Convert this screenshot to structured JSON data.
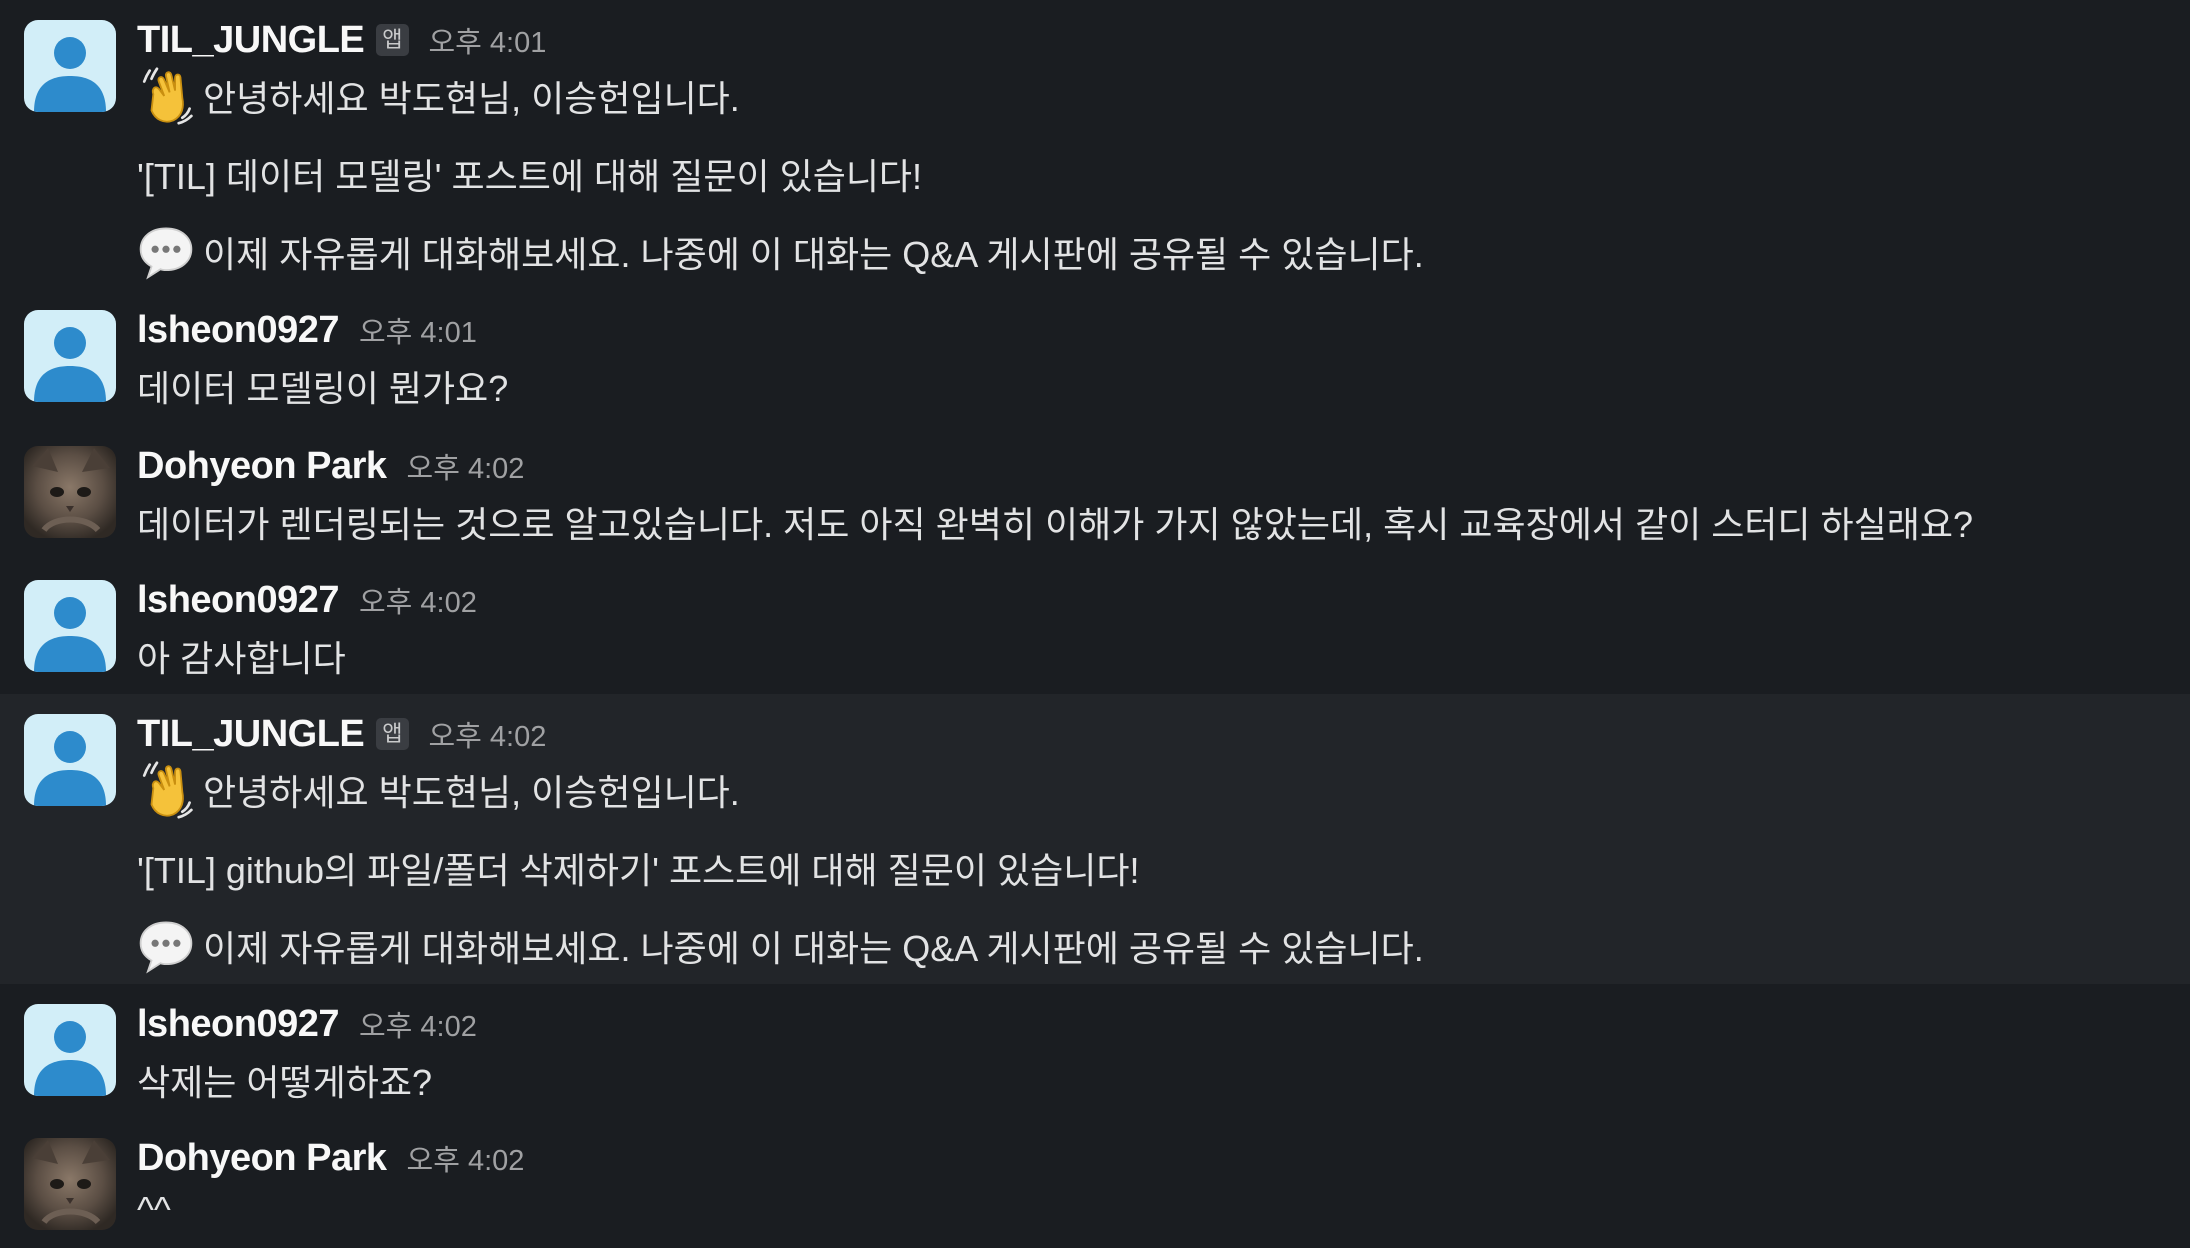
{
  "messages": [
    {
      "author": "TIL_JUNGLE",
      "badge": "앱",
      "time": "오후 4:01",
      "greeting": "안녕하세요 박도현님, 이승헌입니다.",
      "question": "'[TIL] 데이터 모델링' 포스트에 대해 질문이 있습니다!",
      "notice": "이제 자유롭게 대화해보세요. 나중에 이 대화는 Q&A 게시판에 공유될 수 있습니다."
    },
    {
      "author": "lsheon0927",
      "time": "오후 4:01",
      "text": "데이터 모델링이 뭔가요?"
    },
    {
      "author": "Dohyeon Park",
      "time": "오후 4:02",
      "text": "데이터가 렌더링되는 것으로 알고있습니다. 저도 아직 완벽히 이해가 가지 않았는데, 혹시 교육장에서 같이 스터디 하실래요?"
    },
    {
      "author": "lsheon0927",
      "time": "오후 4:02",
      "text": "아 감사합니다"
    },
    {
      "author": "TIL_JUNGLE",
      "badge": "앱",
      "time": "오후 4:02",
      "greeting": "안녕하세요 박도현님, 이승헌입니다.",
      "question": "'[TIL] github의 파일/폴더 삭제하기' 포스트에 대해 질문이 있습니다!",
      "notice": "이제 자유롭게 대화해보세요. 나중에 이 대화는 Q&A 게시판에 공유될 수 있습니다."
    },
    {
      "author": "lsheon0927",
      "time": "오후 4:02",
      "text": "삭제는 어떻게하죠?"
    },
    {
      "author": "Dohyeon Park",
      "time": "오후 4:02",
      "text": "^^"
    }
  ],
  "colors": {
    "background": "#1a1d21",
    "highlight_row": "#222529",
    "avatar_default_bg": "#d2eef8",
    "avatar_default_fg": "#2d8bcc"
  },
  "icons": {
    "waving_hand": "waving-hand-icon",
    "speech_bubble": "speech-bubble-icon",
    "default_avatar": "default-user-avatar",
    "photo_avatar": "cat-photo-avatar"
  }
}
